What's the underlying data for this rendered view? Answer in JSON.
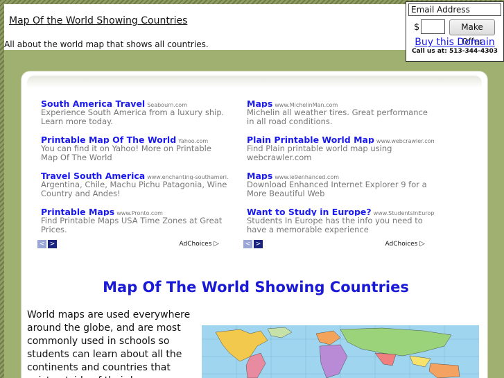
{
  "header": {
    "site_title": "Map Of the World Showing Countries",
    "site_description": "All about the world map that shows all countries."
  },
  "offer_box": {
    "email_placeholder": "Email Address",
    "currency_symbol": "$",
    "make_offer_label": "Make Offer",
    "buy_link": "Buy this Domain",
    "call_text": "Call us at: 513-344-4303"
  },
  "ads": {
    "left": [
      {
        "title": "South America Travel",
        "url": "Seabourn.com",
        "desc": "Experience South America from a luxury ship. Learn more today."
      },
      {
        "title": "Printable Map Of The World",
        "url": "Yahoo.com",
        "desc": "You can find it on Yahoo! More on Printable Map Of The World"
      },
      {
        "title": "Travel South America",
        "url": "www.enchanting-southameri...",
        "desc": "Argentina, Chile, Machu Pichu Patagonia, Wine Country and Andes!"
      },
      {
        "title": "Printable Maps",
        "url": "www.Pronto.com",
        "desc": "Find Printable Maps USA Time Zones at Great Prices."
      }
    ],
    "right": [
      {
        "title": "Maps",
        "url": "www.MichelinMan.com",
        "desc": "Michelin all weather tires. Great performance in all road conditions."
      },
      {
        "title": "Plain Printable World Map",
        "url": "www.webcrawler.com",
        "desc": "Find Plain printable world map using webcrawler.com"
      },
      {
        "title": "Maps",
        "url": "www.ie9enhanced.com",
        "desc": "Download Enhanced Internet Explorer 9 for a More Beautiful Web"
      },
      {
        "title": "Want to Study in Europe?",
        "url": "www.StudentsInEurop...",
        "desc": "Students In Europe has the info you need to have a memorable experience"
      }
    ],
    "adchoices_label": "AdChoices",
    "prev_glyph": "<",
    "next_glyph": ">"
  },
  "main": {
    "heading": "Map Of The World Showing Countries",
    "intro": "World maps are used everywhere around the globe, and are most commonly used in schools so students can learn about all the continents and countries that exist outside of their home areas."
  },
  "colors": {
    "link": "#1a1aee",
    "heading": "#1a1ad6",
    "band": "#9fb070"
  }
}
